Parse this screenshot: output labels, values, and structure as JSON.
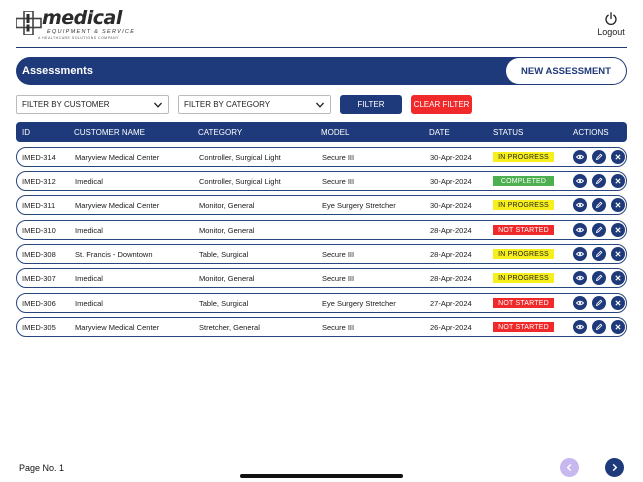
{
  "brand": {
    "name": "medical",
    "tagline": "EQUIPMENT & SERVICE",
    "subtag": "A HEALTHCARE SOLUTIONS COMPANY"
  },
  "header": {
    "logout_label": "Logout"
  },
  "page": {
    "title": "Assessments",
    "new_button": "NEW ASSESSMENT"
  },
  "filters": {
    "customer_label": "FILTER BY CUSTOMER",
    "category_label": "FILTER BY CATEGORY",
    "filter_button": "FILTER",
    "clear_button": "CLEAR FILTER"
  },
  "table": {
    "columns": {
      "id": "ID",
      "customer": "CUSTOMER NAME",
      "category": "CATEGORY",
      "model": "MODEL",
      "date": "DATE",
      "status": "STATUS",
      "actions": "ACTIONS"
    },
    "rows": [
      {
        "id": "IMED-314",
        "customer": "Maryview Medical Center",
        "category": "Controller, Surgical Light",
        "model": "Secure III",
        "date": "30-Apr-2024",
        "status": "IN PROGRESS",
        "status_kind": "progress"
      },
      {
        "id": "IMED-312",
        "customer": "Imedical",
        "category": "Controller, Surgical Light",
        "model": "Secure III",
        "date": "30-Apr-2024",
        "status": "COMPLETED",
        "status_kind": "completed"
      },
      {
        "id": "IMED-311",
        "customer": "Maryview Medical Center",
        "category": "Monitor, General",
        "model": "Eye Surgery Stretcher",
        "date": "30-Apr-2024",
        "status": "IN PROGRESS",
        "status_kind": "progress"
      },
      {
        "id": "IMED-310",
        "customer": "Imedical",
        "category": "Monitor, General",
        "model": "",
        "date": "28-Apr-2024",
        "status": "NOT STARTED",
        "status_kind": "notstarted"
      },
      {
        "id": "IMED-308",
        "customer": "St. Francis - Downtown",
        "category": "Table, Surgical",
        "model": "Secure III",
        "date": "28-Apr-2024",
        "status": "IN PROGRESS",
        "status_kind": "progress"
      },
      {
        "id": "IMED-307",
        "customer": "Imedical",
        "category": "Monitor, General",
        "model": "Secure III",
        "date": "28-Apr-2024",
        "status": "IN PROGRESS",
        "status_kind": "progress"
      },
      {
        "id": "IMED-306",
        "customer": "Imedical",
        "category": "Table, Surgical",
        "model": "Eye Surgery Stretcher",
        "date": "27-Apr-2024",
        "status": "NOT STARTED",
        "status_kind": "notstarted"
      },
      {
        "id": "IMED-305",
        "customer": "Maryview Medical Center",
        "category": "Stretcher, General",
        "model": "Secure III",
        "date": "26-Apr-2024",
        "status": "NOT STARTED",
        "status_kind": "notstarted"
      }
    ]
  },
  "footer": {
    "page_label": "Page No. 1"
  },
  "colors": {
    "primary": "#1f3a7a",
    "danger": "#f02a2a",
    "progress": "#f7ef1c",
    "completed": "#4caf50",
    "prev_disabled": "#c7b8f0"
  }
}
